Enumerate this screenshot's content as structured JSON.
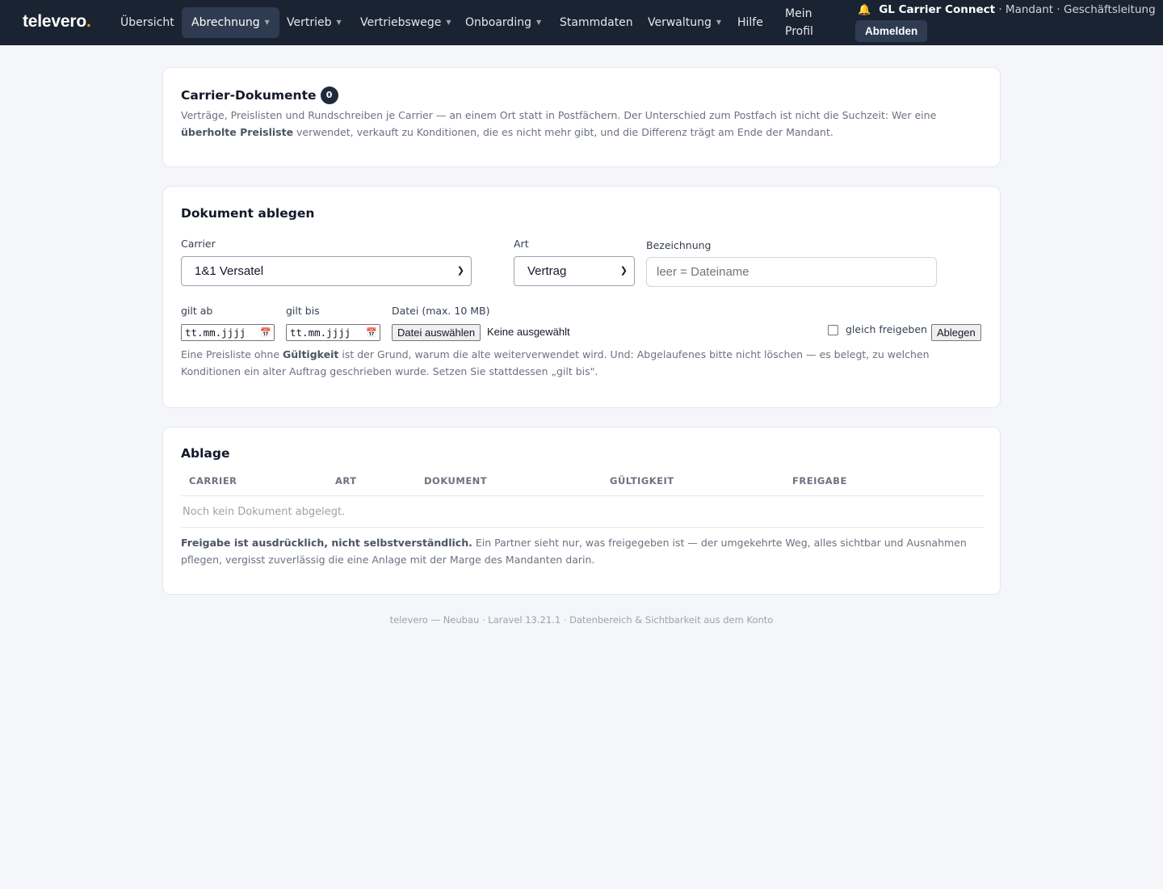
{
  "nav": {
    "brand": "televero",
    "brand_dot": ".",
    "items": [
      {
        "label": "Übersicht",
        "dropdown": false
      },
      {
        "label": "Abrechnung",
        "dropdown": true,
        "active": true
      },
      {
        "label": "Vertrieb",
        "dropdown": true
      },
      {
        "label": "Vertriebswege",
        "dropdown": true
      },
      {
        "label": "Onboarding",
        "dropdown": true
      },
      {
        "label": "Stammdaten",
        "dropdown": false
      },
      {
        "label": "Verwaltung",
        "dropdown": true
      },
      {
        "label": "Hilfe",
        "dropdown": false
      }
    ],
    "caret": "▼",
    "profile": "Mein Profil",
    "bell_icon": "bell-icon",
    "user_name": "GL Carrier Connect",
    "user_role": " · Mandant · Geschäftsleitung",
    "logout": "Abmelden"
  },
  "header_card": {
    "title": "Carrier-Dokumente",
    "count": "0",
    "text_before": "Verträge, Preislisten und Rundschreiben je Carrier — an einem Ort statt in Postfächern. Der Unterschied zum Postfach ist nicht die Suchzeit: Wer eine ",
    "text_bold": "überholte Preisliste",
    "text_after": " verwendet, verkauft zu Konditionen, die es nicht mehr gibt, und die Differenz trägt am Ende der Mandant."
  },
  "form": {
    "title": "Dokument ablegen",
    "carrier_label": "Carrier",
    "carrier_value": "1&1 Versatel",
    "art_label": "Art",
    "art_value": "Vertrag",
    "bezeichnung_label": "Bezeichnung",
    "bezeichnung_placeholder": "leer = Dateiname",
    "gilt_ab_label": "gilt ab",
    "gilt_ab_value": "tt.mm.jjjj",
    "gilt_bis_label": "gilt bis",
    "gilt_bis_value": "tt.mm.jjjj",
    "datei_label": "Datei (max. 10 MB)",
    "datei_button": "Datei auswählen",
    "datei_none": "Keine ausgewählt",
    "freigeben_label": "gleich freigeben",
    "submit": "Ablegen",
    "hint_before": "Eine Preisliste ohne ",
    "hint_bold": "Gültigkeit",
    "hint_after": " ist der Grund, warum die alte weiterverwendet wird. Und: Abgelaufenes bitte nicht löschen — es belegt, zu welchen Konditionen ein alter Auftrag geschrieben wurde. Setzen Sie stattdessen „gilt bis\"."
  },
  "table": {
    "title": "Ablage",
    "columns": [
      "CARRIER",
      "ART",
      "DOKUMENT",
      "GÜLTIGKEIT",
      "FREIGABE"
    ],
    "empty": "Noch kein Dokument abgelegt.",
    "note_bold": "Freigabe ist ausdrücklich, nicht selbstverständlich.",
    "note_rest": " Ein Partner sieht nur, was freigegeben ist — der umgekehrte Weg, alles sichtbar und Ausnahmen pflegen, vergisst zuverlässig die eine Anlage mit der Marge des Mandanten darin."
  },
  "footer": "televero — Neubau · Laravel 13.21.1 · Datenbereich & Sichtbarkeit aus dem Konto"
}
